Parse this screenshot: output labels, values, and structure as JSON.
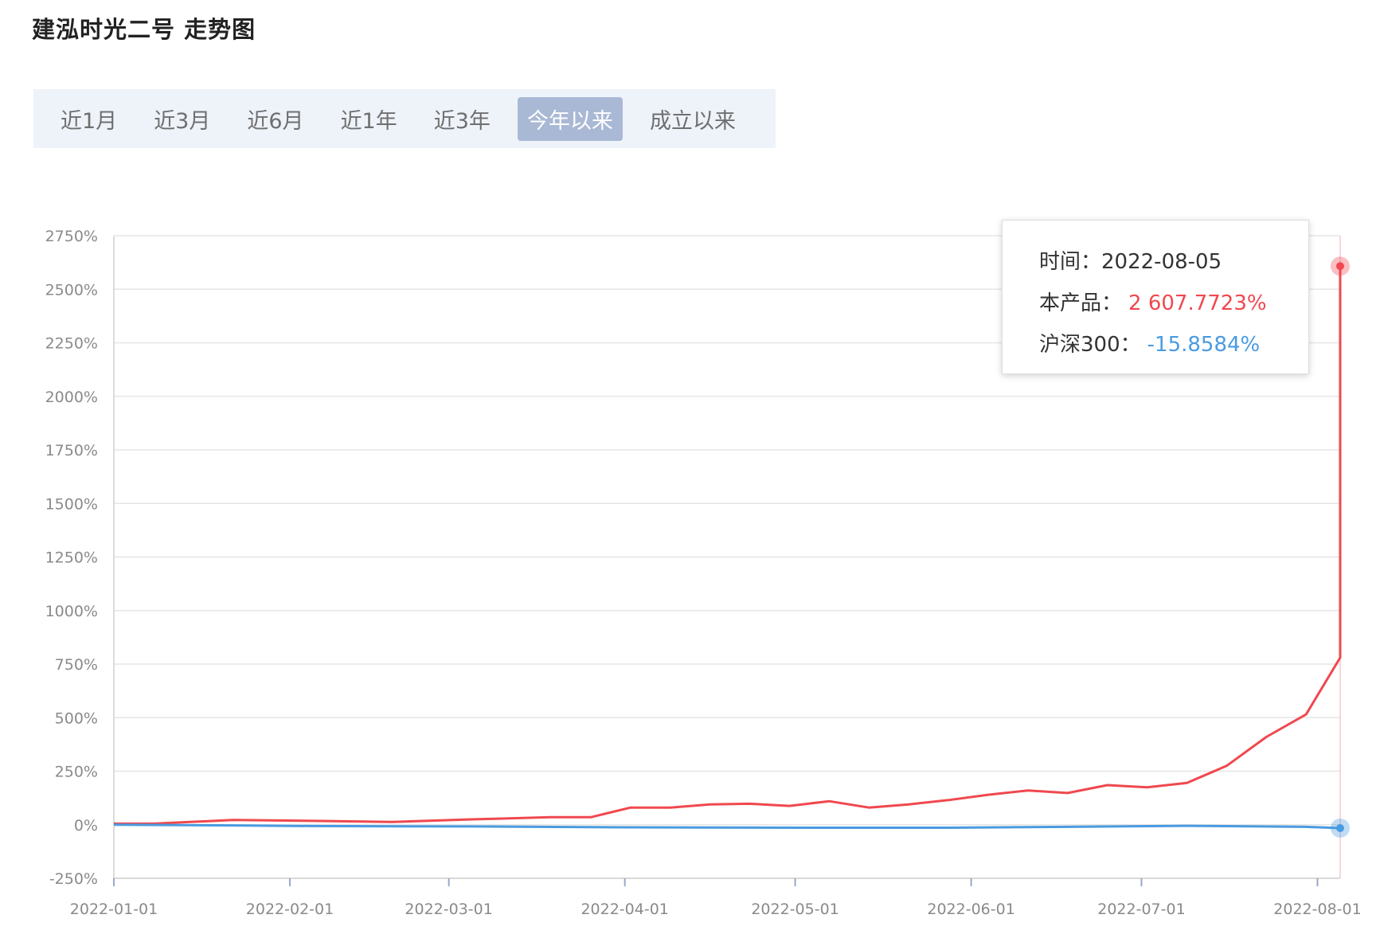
{
  "title": "建泓时光二号 走势图",
  "range_tabs": {
    "items": [
      "近1月",
      "近3月",
      "近6月",
      "近1年",
      "近3年",
      "今年以来",
      "成立以来"
    ],
    "active_index": 5
  },
  "tooltip": {
    "time_label": "时间：",
    "time_value": "2022-08-05",
    "product_label": "本产品：",
    "product_value": "2 607.7723%",
    "index_label": "沪深300：",
    "index_value": "-15.8584%"
  },
  "colors": {
    "product": "#f0484f",
    "index": "#4a9be0",
    "active_tab": "#a9b8d4",
    "tabs_bg": "#eef3fa"
  },
  "chart_data": {
    "type": "line",
    "y_ticks": [
      2750,
      2500,
      2250,
      2000,
      1750,
      1500,
      1250,
      1000,
      750,
      500,
      250,
      0,
      -250
    ],
    "y_tick_labels": [
      "2750%",
      "2500%",
      "2250%",
      "2000%",
      "1750%",
      "1500%",
      "1250%",
      "1000%",
      "750%",
      "500%",
      "250%",
      "0%",
      "-250%"
    ],
    "ylim": [
      -250,
      2750
    ],
    "x_range": [
      "2022-01-01",
      "2022-08-05"
    ],
    "x_ticks": [
      "2022-01-01",
      "2022-02-01",
      "2022-03-01",
      "2022-04-01",
      "2022-05-01",
      "2022-06-01",
      "2022-07-01",
      "2022-08-01"
    ],
    "grid": true,
    "series": [
      {
        "name": "本产品",
        "color": "#f0484f",
        "points": [
          [
            "2022-01-01",
            5
          ],
          [
            "2022-01-08",
            5
          ],
          [
            "2022-01-22",
            22
          ],
          [
            "2022-02-05",
            18
          ],
          [
            "2022-02-19",
            13
          ],
          [
            "2022-03-05",
            25
          ],
          [
            "2022-03-19",
            35
          ],
          [
            "2022-03-26",
            35
          ],
          [
            "2022-04-02",
            80
          ],
          [
            "2022-04-09",
            80
          ],
          [
            "2022-04-16",
            95
          ],
          [
            "2022-04-23",
            98
          ],
          [
            "2022-04-30",
            88
          ],
          [
            "2022-05-07",
            110
          ],
          [
            "2022-05-14",
            80
          ],
          [
            "2022-05-21",
            95
          ],
          [
            "2022-05-28",
            115
          ],
          [
            "2022-06-04",
            140
          ],
          [
            "2022-06-11",
            160
          ],
          [
            "2022-06-18",
            148
          ],
          [
            "2022-06-25",
            185
          ],
          [
            "2022-07-02",
            175
          ],
          [
            "2022-07-09",
            195
          ],
          [
            "2022-07-16",
            275
          ],
          [
            "2022-07-23",
            410
          ],
          [
            "2022-07-30",
            515
          ],
          [
            "2022-08-06",
            780
          ],
          [
            "2022-08-13",
            1610
          ],
          [
            "2022-08-20",
            2607.7723
          ]
        ]
      },
      {
        "name": "沪深300",
        "color": "#4a9be0",
        "points": [
          [
            "2022-01-01",
            0
          ],
          [
            "2022-01-22",
            -3
          ],
          [
            "2022-02-05",
            -6
          ],
          [
            "2022-03-05",
            -8
          ],
          [
            "2022-04-02",
            -12
          ],
          [
            "2022-05-07",
            -14
          ],
          [
            "2022-05-28",
            -14
          ],
          [
            "2022-06-18",
            -10
          ],
          [
            "2022-07-09",
            -5
          ],
          [
            "2022-07-30",
            -10
          ],
          [
            "2022-08-20",
            -15.8584
          ]
        ]
      }
    ]
  }
}
